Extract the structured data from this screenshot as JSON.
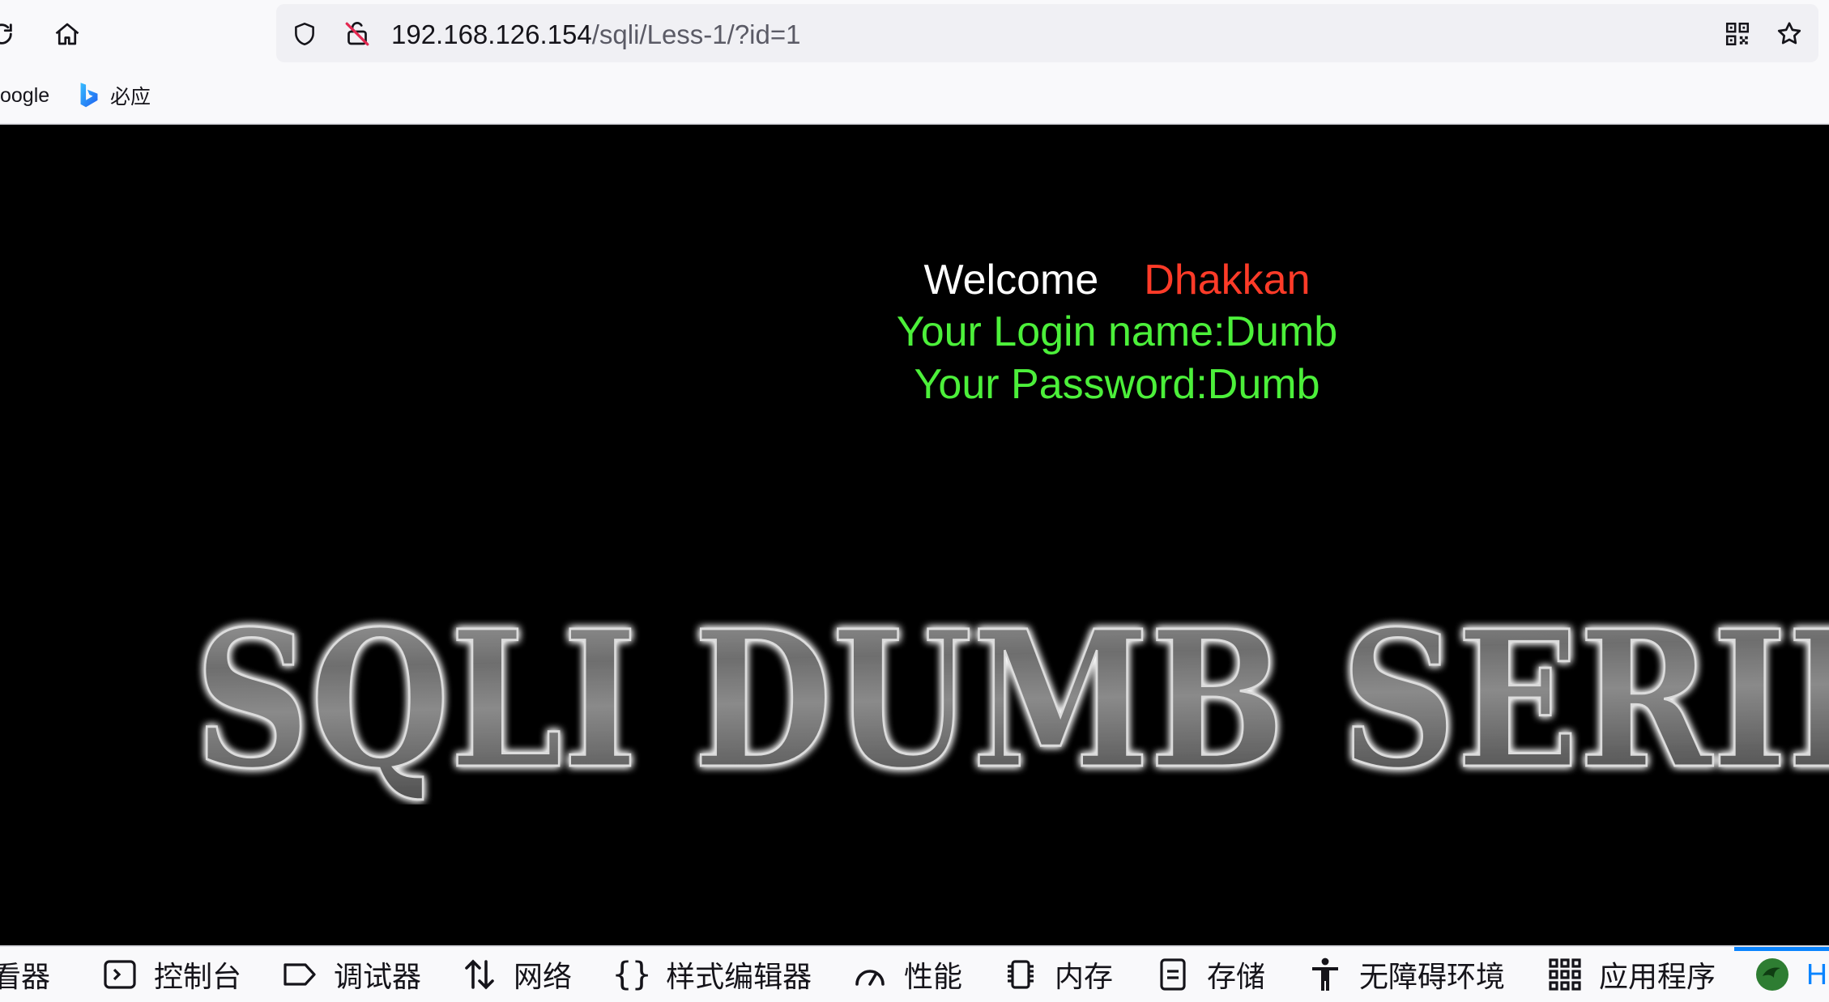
{
  "toolbar": {
    "url_host": "192.168.126.154",
    "url_path": "/sqli/Less-1/?id=1",
    "icons": [
      "reload-icon",
      "home-icon",
      "shield-icon",
      "insecure-lock-icon",
      "qr-code-icon",
      "bookmark-star-icon"
    ]
  },
  "bookmarks": {
    "items": [
      {
        "label": "oogle",
        "icon": "google-icon"
      },
      {
        "label": "必应",
        "icon": "bing-icon"
      }
    ]
  },
  "page": {
    "welcome_word": "Welcome",
    "welcome_name": "Dhakkan",
    "login_line": "Your Login name:Dumb",
    "password_line": "Your Password:Dumb",
    "banner_text": "SQLI DUMB SERIES",
    "colors": {
      "background": "#000000",
      "welcome": "#ffffff",
      "name": "#ff3b28",
      "result": "#4cf03a"
    }
  },
  "devtools": {
    "tabs": [
      {
        "label": "看器",
        "icon": "inspector-icon"
      },
      {
        "label": "控制台",
        "icon": "console-icon"
      },
      {
        "label": "调试器",
        "icon": "debugger-icon"
      },
      {
        "label": "网络",
        "icon": "network-icon"
      },
      {
        "label": "样式编辑器",
        "icon": "style-editor-icon"
      },
      {
        "label": "性能",
        "icon": "performance-icon"
      },
      {
        "label": "内存",
        "icon": "memory-icon"
      },
      {
        "label": "存储",
        "icon": "storage-icon"
      },
      {
        "label": "无障碍环境",
        "icon": "accessibility-icon"
      },
      {
        "label": "应用程序",
        "icon": "application-icon"
      },
      {
        "label": "H",
        "icon": "hackbar-icon"
      }
    ],
    "accent": "#0a84ff"
  }
}
